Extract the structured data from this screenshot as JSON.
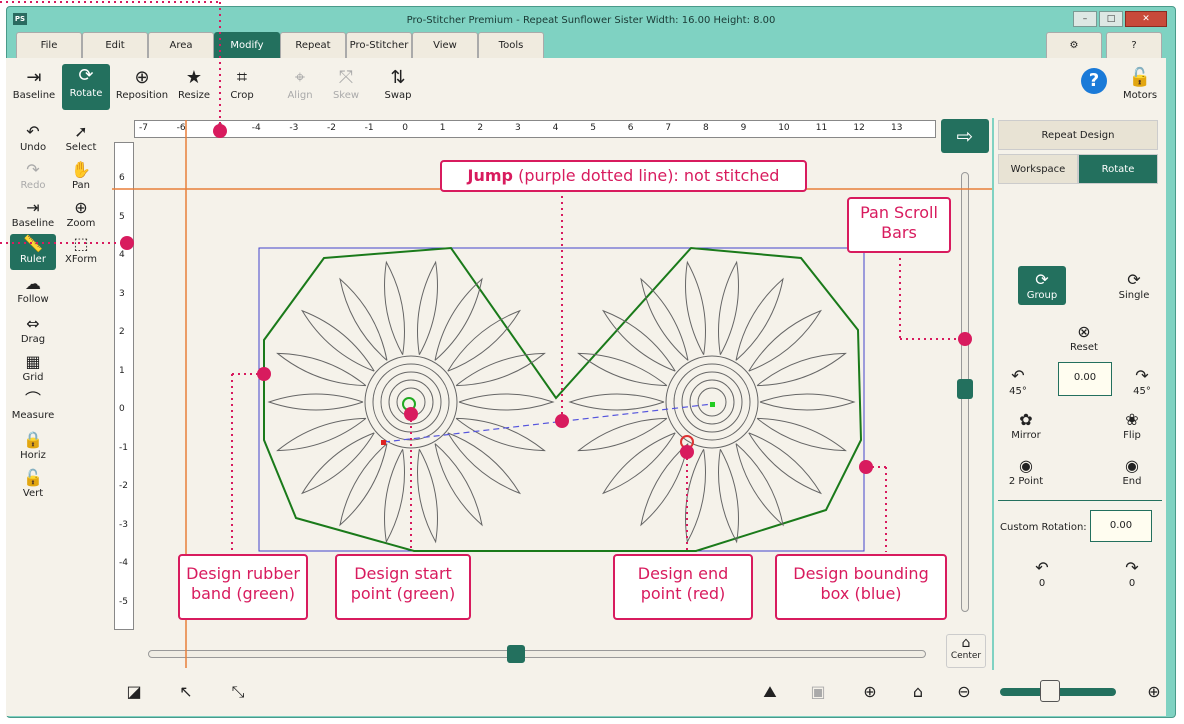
{
  "window": {
    "logo": "PS",
    "title": "Pro-Stitcher Premium   -   Repeat Sunflower Sister   Width: 16.00   Height: 8.00"
  },
  "menu": {
    "tabs": [
      "File",
      "Edit",
      "Area",
      "Modify",
      "Repeat",
      "Pro-Stitcher",
      "View",
      "Tools"
    ],
    "active": "Modify"
  },
  "toolbar": {
    "items": [
      {
        "label": "Baseline",
        "icon": "baseline-icon"
      },
      {
        "label": "Rotate",
        "icon": "rotate-icon"
      },
      {
        "label": "Reposition",
        "icon": "crosshair-icon"
      },
      {
        "label": "Resize",
        "icon": "star-icon"
      },
      {
        "label": "Crop",
        "icon": "crop-icon"
      },
      {
        "label": "Align",
        "icon": "align-icon"
      },
      {
        "label": "Skew",
        "icon": "skew-icon"
      },
      {
        "label": "Swap",
        "icon": "swap-icon"
      }
    ],
    "help": "?",
    "motors": "Motors"
  },
  "left": {
    "items": [
      "Undo",
      "Select",
      "Redo",
      "Pan",
      "Baseline",
      "Zoom",
      "Ruler",
      "XForm",
      "Follow",
      "Drag",
      "Grid",
      "Measure",
      "Horiz",
      "Vert"
    ]
  },
  "ruler": {
    "h": [
      "-7",
      "-6",
      "-5",
      "-4",
      "-3",
      "-2",
      "-1",
      "0",
      "1",
      "2",
      "3",
      "4",
      "5",
      "6",
      "7",
      "8",
      "9",
      "10",
      "11",
      "12",
      "13"
    ],
    "v": [
      "6",
      "5",
      "4",
      "3",
      "2",
      "1",
      "0",
      "-1",
      "-2",
      "-3",
      "-4",
      "-5"
    ]
  },
  "right": {
    "header": "Repeat Design",
    "tab1": "Workspace",
    "tab2": "Rotate",
    "group": "Group",
    "single": "Single",
    "reset": "Reset",
    "rotl": "45°",
    "rotr": "45°",
    "rotval": "0.00",
    "mirror": "Mirror",
    "flip": "Flip",
    "twopoint": "2 Point",
    "end": "End",
    "custom_label": "Custom Rotation:",
    "custom_val": "0.00",
    "cl": "0",
    "cr": "0",
    "center": "Center"
  },
  "callouts": {
    "jump_bold": "Jump",
    "jump_rest": " (purple dotted line): not stitched",
    "pan": "Pan Scroll Bars",
    "rubber": "Design rubber band (green)",
    "start": "Design start point (green)",
    "end": "Design end point (red)",
    "bbox": "Design bounding box (blue)"
  },
  "colors": {
    "accent": "#23705e",
    "callout": "#d81b5e",
    "rubber": "#1a7a1a",
    "bbox": "#4444cc"
  }
}
